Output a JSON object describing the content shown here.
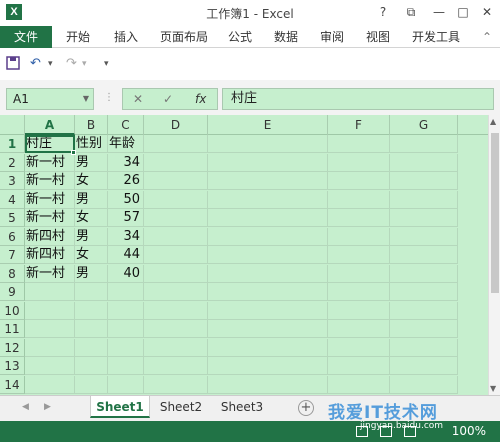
{
  "window": {
    "title": "工作簿1 - Excel",
    "controls": [
      "?",
      "⧉",
      "—",
      "□",
      "✕"
    ]
  },
  "ribbon": {
    "file": "文件",
    "tabs": [
      "开始",
      "插入",
      "页面布局",
      "公式",
      "数据",
      "审阅",
      "视图",
      "开发工具"
    ]
  },
  "formula_bar": {
    "name_box": "A1",
    "fx": "fx",
    "value": "村庄"
  },
  "columns": [
    "A",
    "B",
    "C",
    "D",
    "E",
    "F",
    "G"
  ],
  "rows": [
    "1",
    "2",
    "3",
    "4",
    "5",
    "6",
    "7",
    "8",
    "9",
    "10",
    "11",
    "12",
    "13",
    "14"
  ],
  "table": [
    [
      "村庄",
      "性别",
      "年龄"
    ],
    [
      "新一村",
      "男",
      "34"
    ],
    [
      "新一村",
      "女",
      "26"
    ],
    [
      "新一村",
      "男",
      "50"
    ],
    [
      "新一村",
      "女",
      "57"
    ],
    [
      "新四村",
      "男",
      "34"
    ],
    [
      "新四村",
      "女",
      "44"
    ],
    [
      "新一村",
      "男",
      "40"
    ]
  ],
  "sheets": [
    "Sheet1",
    "Sheet2",
    "Sheet3"
  ],
  "active_sheet": "Sheet1",
  "status": {
    "zoom": "100%"
  },
  "watermark": {
    "main": "我爱IT技术网",
    "sub": "jingyan.baidu.com"
  },
  "colors": {
    "excel_green": "#217346",
    "cell_fill": "#c6efce"
  }
}
